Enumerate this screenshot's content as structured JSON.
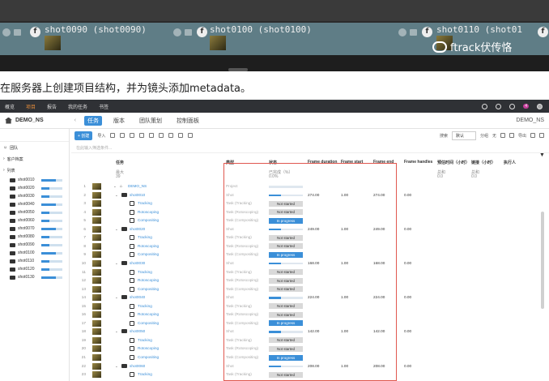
{
  "strip": {
    "clips": [
      {
        "label": "shot0090 (shot0090)"
      },
      {
        "label": "shot0100 (shot0100)"
      },
      {
        "label": "shot0110 (shot01"
      }
    ],
    "watermark": "ftrack伏传恪"
  },
  "caption": "在服务器上创建项目结构，并为镜头添加metadata。",
  "topnav": {
    "items": [
      "概览",
      "项目",
      "报告",
      "我的任务",
      "书签"
    ],
    "badge": "4"
  },
  "project": {
    "name": "DEMO_NS",
    "tabs": [
      "任务",
      "版本",
      "团队策划",
      "控制面板"
    ],
    "right": "DEMO_NS"
  },
  "sidebar": {
    "placeholder": "",
    "sections": [
      "团队",
      "客户档案",
      "列表"
    ],
    "shots": [
      "shot0010",
      "shot0020",
      "shot0030",
      "shot0040",
      "shot0050",
      "shot0060",
      "shot0070",
      "shot0080",
      "shot0090",
      "shot0100",
      "shot0110",
      "shot0120",
      "shot0130"
    ]
  },
  "toolbar": {
    "create": "+ 创建",
    "import": "导入",
    "search_label": "搜索",
    "default": "默认",
    "group": "分组",
    "none": "无",
    "export": "导出"
  },
  "filter": {
    "placeholder": "在此输入筛选条件..."
  },
  "grid": {
    "headers": {
      "task": "任务",
      "type": "类型",
      "status": "状态",
      "fd": "Frame duration",
      "fs": "Frame start",
      "fe": "Frame end",
      "fh": "Frame handles",
      "bid": "预估时间（小时）",
      "worked": "链接（小时）",
      "assignee": "执行人"
    },
    "subs": {
      "task_max": "最大",
      "task_val": "39",
      "status_lbl": "已完成（%）",
      "status_val": "0.0%",
      "bid_lbl": "总和",
      "bid_val": "0.0",
      "worked_lbl": "总和",
      "worked_val": "0.0"
    },
    "rows": [
      {
        "n": "1",
        "kind": "project",
        "name": "DEMO_NS",
        "type": "Project"
      },
      {
        "n": "2",
        "kind": "shot",
        "name": "shot0010",
        "type": "Shot",
        "fd": "274.00",
        "fs": "1.00",
        "fe": "274.00",
        "fh": "0.00"
      },
      {
        "n": "3",
        "kind": "task",
        "name": "Tracking",
        "type": "Task (Tracking)",
        "status": "Not started"
      },
      {
        "n": "4",
        "kind": "task",
        "name": "Rotoscoping",
        "type": "Task (Rotoscoping)",
        "status": "Not started"
      },
      {
        "n": "5",
        "kind": "task",
        "name": "Compositing",
        "type": "Task (Compositing)",
        "status": "In progress"
      },
      {
        "n": "6",
        "kind": "shot",
        "name": "shot0020",
        "type": "Shot",
        "fd": "249.00",
        "fs": "1.00",
        "fe": "249.00",
        "fh": "0.00"
      },
      {
        "n": "7",
        "kind": "task",
        "name": "Tracking",
        "type": "Task (Tracking)",
        "status": "Not started"
      },
      {
        "n": "8",
        "kind": "task",
        "name": "Rotoscoping",
        "type": "Task (Rotoscoping)",
        "status": "Not started"
      },
      {
        "n": "9",
        "kind": "task",
        "name": "Compositing",
        "type": "Task (Compositing)",
        "status": "In progress"
      },
      {
        "n": "10",
        "kind": "shot",
        "name": "shot0030",
        "type": "Shot",
        "fd": "168.00",
        "fs": "1.00",
        "fe": "168.00",
        "fh": "0.00"
      },
      {
        "n": "11",
        "kind": "task",
        "name": "Tracking",
        "type": "Task (Tracking)",
        "status": "Not started"
      },
      {
        "n": "12",
        "kind": "task",
        "name": "Rotoscoping",
        "type": "Task (Rotoscoping)",
        "status": "Not started"
      },
      {
        "n": "13",
        "kind": "task",
        "name": "Compositing",
        "type": "Task (Compositing)",
        "status": "Not started"
      },
      {
        "n": "14",
        "kind": "shot",
        "name": "shot0040",
        "type": "Shot",
        "fd": "224.00",
        "fs": "1.00",
        "fe": "224.00",
        "fh": "0.00"
      },
      {
        "n": "15",
        "kind": "task",
        "name": "Tracking",
        "type": "Task (Tracking)",
        "status": "Not started"
      },
      {
        "n": "16",
        "kind": "task",
        "name": "Rotoscoping",
        "type": "Task (Rotoscoping)",
        "status": "Not started"
      },
      {
        "n": "17",
        "kind": "task",
        "name": "Compositing",
        "type": "Task (Compositing)",
        "status": "In progress"
      },
      {
        "n": "18",
        "kind": "shot",
        "name": "shot0050",
        "type": "Shot",
        "fd": "142.00",
        "fs": "1.00",
        "fe": "142.00",
        "fh": "0.00"
      },
      {
        "n": "19",
        "kind": "task",
        "name": "Tracking",
        "type": "Task (Tracking)",
        "status": "Not started"
      },
      {
        "n": "20",
        "kind": "task",
        "name": "Rotoscoping",
        "type": "Task (Rotoscoping)",
        "status": "Not started"
      },
      {
        "n": "21",
        "kind": "task",
        "name": "Compositing",
        "type": "Task (Compositing)",
        "status": "In progress"
      },
      {
        "n": "22",
        "kind": "shot",
        "name": "shot0060",
        "type": "Shot",
        "fd": "208.00",
        "fs": "1.00",
        "fe": "208.00",
        "fh": "0.00"
      },
      {
        "n": "23",
        "kind": "task",
        "name": "Tracking",
        "type": "Task (Tracking)",
        "status": "Not started"
      }
    ]
  },
  "colors": {
    "accent": "#3b8fd8",
    "highlight_box": "#e0584f",
    "nav_bg": "#2f3135"
  }
}
